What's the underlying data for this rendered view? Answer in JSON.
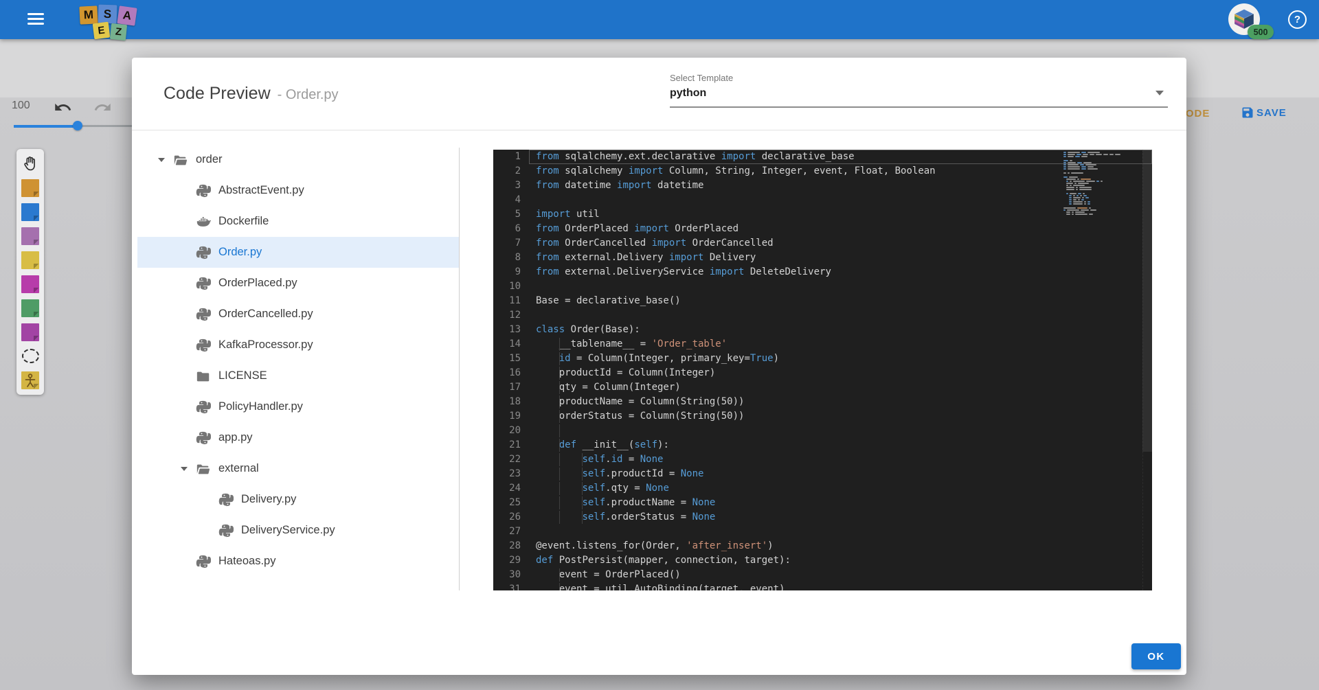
{
  "topbar": {
    "logo": {
      "tiles": [
        {
          "letter": "M",
          "color": "#d2962f"
        },
        {
          "letter": "S",
          "color": "#5b8ad2"
        },
        {
          "letter": "A",
          "color": "#b27abc"
        },
        {
          "letter": "E",
          "color": "#e2c84b"
        },
        {
          "letter": "Z",
          "color": "#76b18e"
        }
      ]
    },
    "badge": "500",
    "help_label": "?"
  },
  "toolbar": {
    "zoom_level": "100",
    "code_label": "CODE",
    "save_label": "SAVE"
  },
  "palette": {
    "items": [
      {
        "name": "pan-tool",
        "type": "hand",
        "color": ""
      },
      {
        "name": "sticker-orange",
        "type": "note",
        "color": "#cf9233"
      },
      {
        "name": "sticker-blue",
        "type": "note",
        "color": "#2b79cf"
      },
      {
        "name": "sticker-violet",
        "type": "note",
        "color": "#a570ae"
      },
      {
        "name": "sticker-yellow",
        "type": "note",
        "color": "#d8bd45"
      },
      {
        "name": "sticker-magenta",
        "type": "note",
        "color": "#b73caa"
      },
      {
        "name": "sticker-green",
        "type": "note",
        "color": "#4f9c66"
      },
      {
        "name": "sticker-purple",
        "type": "note",
        "color": "#a244a4"
      },
      {
        "name": "lasso",
        "type": "lasso",
        "color": ""
      },
      {
        "name": "actor",
        "type": "actor",
        "color": "#d4b544"
      }
    ]
  },
  "dialog": {
    "title": "Code Preview",
    "subtitle": "- Order.py",
    "template_select": {
      "label": "Select Template",
      "value": "python"
    },
    "ok_label": "OK",
    "tree": [
      {
        "label": "order",
        "icon": "folder-open",
        "depth": 0,
        "expanded": true
      },
      {
        "label": "AbstractEvent.py",
        "icon": "python",
        "depth": 1
      },
      {
        "label": "Dockerfile",
        "icon": "docker",
        "depth": 1
      },
      {
        "label": "Order.py",
        "icon": "python",
        "depth": 1,
        "selected": true
      },
      {
        "label": "OrderPlaced.py",
        "icon": "python",
        "depth": 1
      },
      {
        "label": "OrderCancelled.py",
        "icon": "python",
        "depth": 1
      },
      {
        "label": "KafkaProcessor.py",
        "icon": "python",
        "depth": 1
      },
      {
        "label": "LICENSE",
        "icon": "folder",
        "depth": 1
      },
      {
        "label": "PolicyHandler.py",
        "icon": "python",
        "depth": 1
      },
      {
        "label": "app.py",
        "icon": "python",
        "depth": 1
      },
      {
        "label": "external",
        "icon": "folder-open",
        "depth": 1,
        "expanded": true
      },
      {
        "label": "Delivery.py",
        "icon": "python",
        "depth": 2
      },
      {
        "label": "DeliveryService.py",
        "icon": "python",
        "depth": 2
      },
      {
        "label": "Hateoas.py",
        "icon": "python",
        "depth": 1
      }
    ],
    "editor": {
      "lines": [
        {
          "n": 1,
          "cur": true,
          "t": [
            [
              "k",
              "from"
            ],
            [
              "p",
              " sqlalchemy.ext.declarative "
            ],
            [
              "k",
              "import"
            ],
            [
              "p",
              " declarative_base"
            ]
          ]
        },
        {
          "n": 2,
          "t": [
            [
              "k",
              "from"
            ],
            [
              "p",
              " sqlalchemy "
            ],
            [
              "k",
              "import"
            ],
            [
              "p",
              " Column, String, Integer, event, Float, Boolean"
            ]
          ]
        },
        {
          "n": 3,
          "t": [
            [
              "k",
              "from"
            ],
            [
              "p",
              " datetime "
            ],
            [
              "k",
              "import"
            ],
            [
              "p",
              " datetime"
            ]
          ]
        },
        {
          "n": 4,
          "t": []
        },
        {
          "n": 5,
          "t": [
            [
              "k",
              "import"
            ],
            [
              "p",
              " util"
            ]
          ]
        },
        {
          "n": 6,
          "t": [
            [
              "k",
              "from"
            ],
            [
              "p",
              " OrderPlaced "
            ],
            [
              "k",
              "import"
            ],
            [
              "p",
              " OrderPlaced"
            ]
          ]
        },
        {
          "n": 7,
          "t": [
            [
              "k",
              "from"
            ],
            [
              "p",
              " OrderCancelled "
            ],
            [
              "k",
              "import"
            ],
            [
              "p",
              " OrderCancelled"
            ]
          ]
        },
        {
          "n": 8,
          "t": [
            [
              "k",
              "from"
            ],
            [
              "p",
              " external.Delivery "
            ],
            [
              "k",
              "import"
            ],
            [
              "p",
              " Delivery"
            ]
          ]
        },
        {
          "n": 9,
          "t": [
            [
              "k",
              "from"
            ],
            [
              "p",
              " external.DeliveryService "
            ],
            [
              "k",
              "import"
            ],
            [
              "p",
              " DeleteDelivery"
            ]
          ]
        },
        {
          "n": 10,
          "t": []
        },
        {
          "n": 11,
          "t": [
            [
              "p",
              "Base = declarative_base()"
            ]
          ]
        },
        {
          "n": 12,
          "t": []
        },
        {
          "n": 13,
          "t": [
            [
              "k",
              "class"
            ],
            [
              "p",
              " Order(Base):"
            ]
          ]
        },
        {
          "n": 14,
          "t": [
            [
              "p",
              "    __tablename__ = "
            ],
            [
              "s",
              "'Order_table'"
            ]
          ]
        },
        {
          "n": 15,
          "t": [
            [
              "p",
              "    "
            ],
            [
              "k",
              "id"
            ],
            [
              "p",
              " = Column(Integer, primary_key="
            ],
            [
              "k",
              "True"
            ],
            [
              "p",
              ")"
            ]
          ]
        },
        {
          "n": 16,
          "t": [
            [
              "p",
              "    productId = Column(Integer)"
            ]
          ]
        },
        {
          "n": 17,
          "t": [
            [
              "p",
              "    qty = Column(Integer)"
            ]
          ]
        },
        {
          "n": 18,
          "t": [
            [
              "p",
              "    productName = Column(String(50))"
            ]
          ]
        },
        {
          "n": 19,
          "t": [
            [
              "p",
              "    orderStatus = Column(String(50))"
            ]
          ]
        },
        {
          "n": 20,
          "t": [],
          "g": [
            4
          ]
        },
        {
          "n": 21,
          "t": [
            [
              "p",
              "    "
            ],
            [
              "k",
              "def"
            ],
            [
              "p",
              " __init__("
            ],
            [
              "k",
              "self"
            ],
            [
              "p",
              "):"
            ]
          ]
        },
        {
          "n": 22,
          "t": [
            [
              "p",
              "        "
            ],
            [
              "k",
              "self"
            ],
            [
              "p",
              "."
            ],
            [
              "k",
              "id"
            ],
            [
              "p",
              " = "
            ],
            [
              "k",
              "None"
            ]
          ]
        },
        {
          "n": 23,
          "t": [
            [
              "p",
              "        "
            ],
            [
              "k",
              "self"
            ],
            [
              "p",
              ".productId = "
            ],
            [
              "k",
              "None"
            ]
          ]
        },
        {
          "n": 24,
          "t": [
            [
              "p",
              "        "
            ],
            [
              "k",
              "self"
            ],
            [
              "p",
              ".qty = "
            ],
            [
              "k",
              "None"
            ]
          ]
        },
        {
          "n": 25,
          "t": [
            [
              "p",
              "        "
            ],
            [
              "k",
              "self"
            ],
            [
              "p",
              ".productName = "
            ],
            [
              "k",
              "None"
            ]
          ]
        },
        {
          "n": 26,
          "t": [
            [
              "p",
              "        "
            ],
            [
              "k",
              "self"
            ],
            [
              "p",
              ".orderStatus = "
            ],
            [
              "k",
              "None"
            ]
          ]
        },
        {
          "n": 27,
          "t": []
        },
        {
          "n": 28,
          "t": [
            [
              "p",
              "@event.listens_for(Order, "
            ],
            [
              "s",
              "'after_insert'"
            ],
            [
              "p",
              ")"
            ]
          ]
        },
        {
          "n": 29,
          "t": [
            [
              "k",
              "def"
            ],
            [
              "p",
              " PostPersist(mapper, connection, target):"
            ]
          ]
        },
        {
          "n": 30,
          "t": [
            [
              "p",
              "    event = OrderPlaced()"
            ]
          ]
        },
        {
          "n": 31,
          "t": [
            [
              "p",
              "    event = util.AutoBinding(target, event)"
            ]
          ]
        }
      ]
    }
  },
  "colors": {
    "accent": "#1976d2",
    "topbar": "#1f73c9",
    "code_button": "#c2913c",
    "save_button": "#2474ca",
    "editor_bg": "#1f1f1f",
    "keyword": "#569cd6",
    "string": "#ce9178",
    "text": "#d4d4d4",
    "line_number": "#8a8a8a",
    "selected_file_bg": "#e3eefb",
    "badge_bg": "#4c9f61"
  }
}
